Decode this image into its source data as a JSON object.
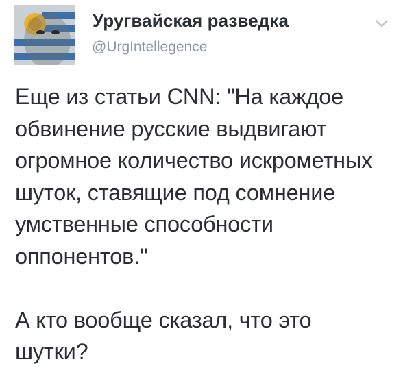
{
  "tweet": {
    "author": {
      "display_name": "Уругвайская разведка",
      "handle": "@UrgIntellegence",
      "avatar_icon": "uruguay-flag-face-avatar"
    },
    "menu_icon": "chevron-down-icon",
    "text_lines": [
      "Еще из статьи CNN: \"На каждое",
      "обвинение русские выдвигают",
      "огромное количество искрометных",
      "шуток, ставящие под сомнение",
      "умственные способности",
      "оппонентов.\""
    ],
    "text_lines_2": [
      "А кто вообще сказал, что это",
      "шутки?"
    ]
  },
  "colors": {
    "text": "#292f33",
    "muted": "#8899a6",
    "chevron": "#b1bbc3"
  }
}
